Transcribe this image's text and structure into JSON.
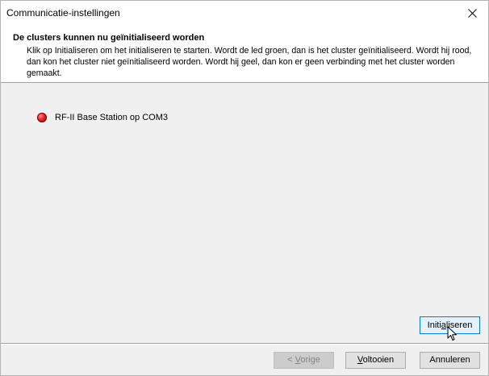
{
  "window": {
    "title": "Communicatie-instellingen",
    "close_icon": "close-icon"
  },
  "header": {
    "title": "De clusters kunnen nu geïnitialiseerd worden",
    "description": "Klik op Initialiseren om het initialiseren te starten. Wordt de led groen, dan is het cluster geïnitialiseerd. Wordt hij rood, dan kon het cluster niet geïnitialiseerd worden. Wordt hij geel, dan kon er geen verbinding met het cluster worden gemaakt."
  },
  "clusters": [
    {
      "name": "RF-II Base Station op COM3",
      "status_color": "#e02020",
      "icon": "red-led-icon"
    }
  ],
  "buttons": {
    "initialize": {
      "prefix": "Initi",
      "mnemonic": "a",
      "suffix": "liseren"
    },
    "previous": {
      "prefix": "< ",
      "mnemonic": "V",
      "suffix": "orige"
    },
    "finish": {
      "prefix": "",
      "mnemonic": "V",
      "suffix": "oltooien"
    },
    "cancel": "Annuleren"
  }
}
